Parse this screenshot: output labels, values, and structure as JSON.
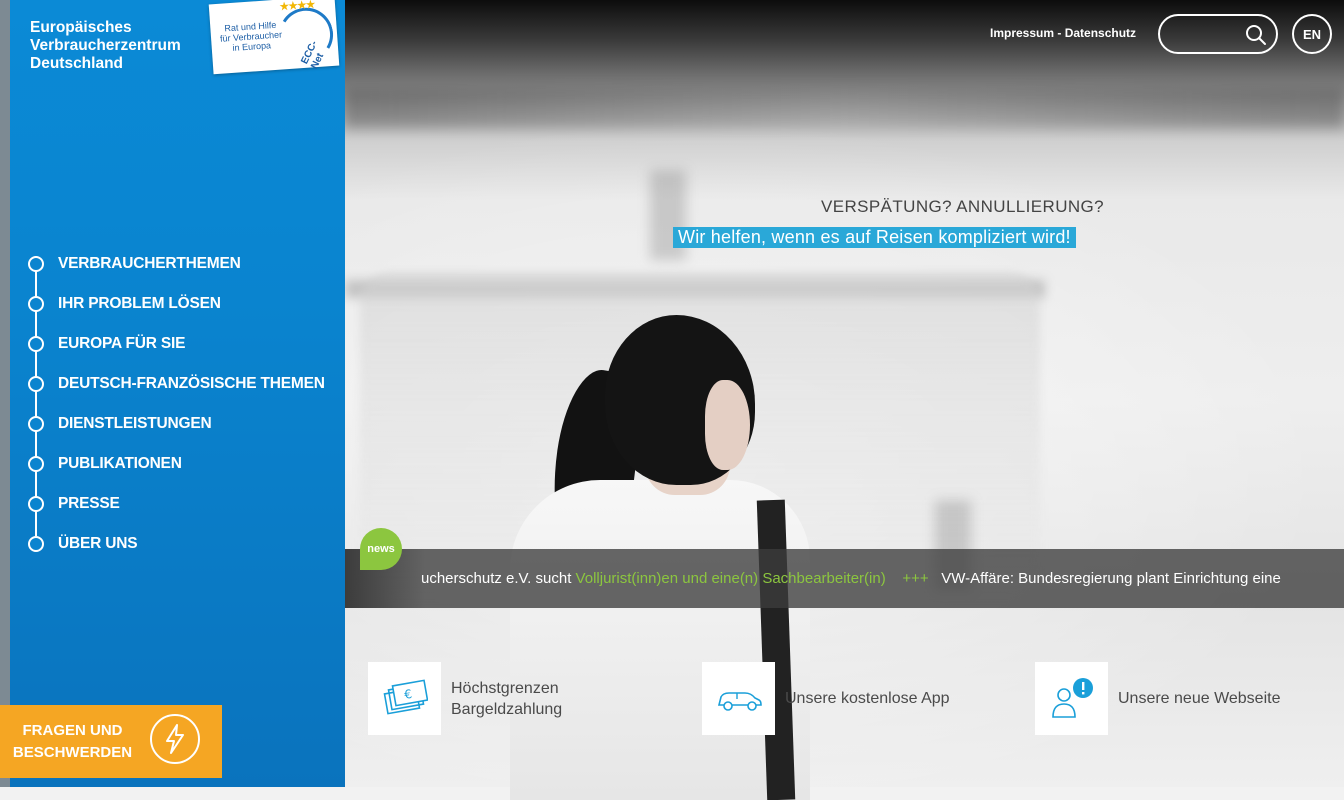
{
  "brand": {
    "line1": "Europäisches",
    "line2": "Verbraucherzentrum",
    "line3": "Deutschland",
    "ecc_text1": "Rat und Hilfe",
    "ecc_text2": "für Verbraucher",
    "ecc_text3": "in Europa",
    "ecc_net": "ECC-Net"
  },
  "nav": {
    "items": [
      {
        "label": "VERBRAUCHERTHEMEN"
      },
      {
        "label": "IHR PROBLEM LÖSEN"
      },
      {
        "label": "EUROPA FÜR SIE"
      },
      {
        "label": "DEUTSCH-FRANZÖSISCHE THEMEN"
      },
      {
        "label": "DIENSTLEISTUNGEN"
      },
      {
        "label": "PUBLIKATIONEN"
      },
      {
        "label": "PRESSE"
      },
      {
        "label": "ÜBER UNS"
      }
    ]
  },
  "cta": {
    "line1": "FRAGEN UND",
    "line2": "BESCHWERDEN"
  },
  "header": {
    "impressum": "Impressum",
    "separator": " - ",
    "datenschutz": "Datenschutz",
    "search_value": "",
    "lang": "EN"
  },
  "hero": {
    "headline": "VERSPÄTUNG? ANNULLIERUNG?",
    "subheadline": "Wir helfen, wenn es auf Reisen kompliziert wird!"
  },
  "news": {
    "badge": "news",
    "text1": "ucherschutz e.V. sucht ",
    "link1": "Volljurist(inn)en und eine(n) Sachbearbeiter(in)",
    "sep": "+++",
    "text2": "VW-Affäre: Bundesregierung plant Einrichtung eine"
  },
  "features": [
    {
      "line1": "Höchstgrenzen",
      "line2": "Bargeldzahlung",
      "icon": "money-icon"
    },
    {
      "line1": "Unsere kostenlose App",
      "line2": "",
      "icon": "car-icon"
    },
    {
      "line1": "Unsere neue Webseite",
      "line2": "",
      "icon": "user-alert-icon"
    }
  ],
  "colors": {
    "primary": "#0a84cf",
    "accent": "#f5a623",
    "news_green": "#8cc63f",
    "highlight": "#2aa8d8"
  }
}
